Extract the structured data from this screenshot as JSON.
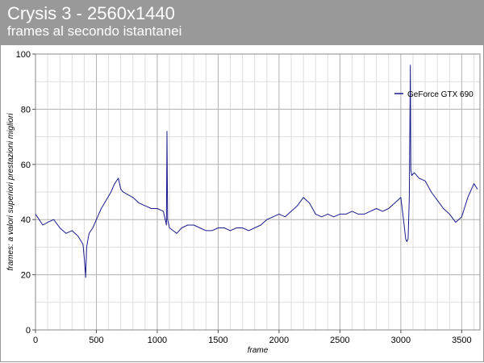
{
  "header": {
    "title": "Crysis 3 - 2560x1440",
    "subtitle": "frames al secondo istantanei"
  },
  "colors": {
    "header_bg": "#999999",
    "series": "#1a1a8c",
    "grid_major": "#b0b0b0",
    "grid_minor": "#dddddd"
  },
  "chart_data": {
    "type": "line",
    "title": "Crysis 3 - 2560x1440",
    "subtitle": "frames al secondo istantanei",
    "xlabel": "frame",
    "ylabel": "frames: a valori superiori prestazioni migliori",
    "xlim": [
      0,
      3650
    ],
    "ylim": [
      0,
      100
    ],
    "x_ticks": [
      0,
      500,
      1000,
      1500,
      2000,
      2500,
      3000,
      3500
    ],
    "y_ticks": [
      0,
      20,
      40,
      60,
      80,
      100
    ],
    "grid": true,
    "legend_position": "top-right",
    "series": [
      {
        "name": "GeForce GTX 690",
        "color": "#1a1a8c",
        "x": [
          0,
          30,
          60,
          100,
          150,
          200,
          250,
          300,
          350,
          390,
          405,
          412,
          420,
          440,
          470,
          500,
          540,
          580,
          620,
          650,
          680,
          700,
          720,
          760,
          800,
          850,
          900,
          950,
          1000,
          1050,
          1075,
          1080,
          1085,
          1100,
          1130,
          1160,
          1200,
          1250,
          1300,
          1350,
          1400,
          1450,
          1500,
          1550,
          1600,
          1650,
          1700,
          1750,
          1800,
          1850,
          1900,
          1950,
          2000,
          2050,
          2100,
          2150,
          2200,
          2250,
          2300,
          2350,
          2400,
          2450,
          2500,
          2550,
          2600,
          2650,
          2700,
          2750,
          2800,
          2850,
          2900,
          2950,
          3000,
          3030,
          3040,
          3050,
          3060,
          3070,
          3078,
          3082,
          3090,
          3110,
          3150,
          3200,
          3250,
          3300,
          3350,
          3400,
          3450,
          3500,
          3550,
          3600,
          3630
        ],
        "y": [
          42,
          40,
          38,
          39,
          40,
          37,
          35,
          36,
          34,
          31,
          24,
          19,
          30,
          35,
          37,
          40,
          44,
          47,
          50,
          53,
          55,
          51,
          50,
          49,
          48,
          46,
          45,
          44,
          44,
          43,
          38,
          72,
          40,
          37,
          36,
          35,
          37,
          38,
          38,
          37,
          36,
          36,
          37,
          37,
          36,
          37,
          37,
          36,
          37,
          38,
          40,
          41,
          42,
          41,
          43,
          45,
          48,
          46,
          42,
          41,
          42,
          41,
          42,
          42,
          43,
          42,
          42,
          43,
          44,
          43,
          44,
          46,
          48,
          37,
          33,
          32,
          33,
          48,
          96,
          58,
          56,
          57,
          55,
          54,
          50,
          47,
          44,
          42,
          39,
          41,
          48,
          53,
          51
        ]
      }
    ]
  }
}
